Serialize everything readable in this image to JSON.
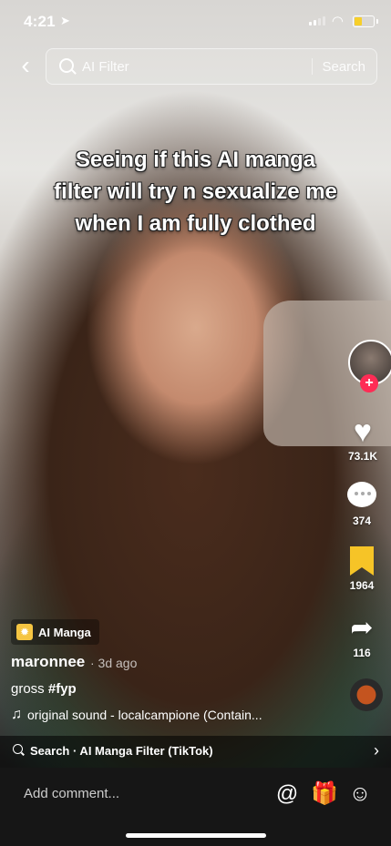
{
  "status_bar": {
    "time": "4:21",
    "location_glyph": "➤",
    "battery_color": "#f7cf2a",
    "battery_level": 0.45
  },
  "search": {
    "query": "AI Filter",
    "button": "Search"
  },
  "caption": {
    "line1": "Seeing if this AI manga",
    "line2": "filter will try n sexualize me",
    "line3": "when I am fully clothed"
  },
  "actions": {
    "likes": "73.1K",
    "comments": "374",
    "saves": "1964",
    "shares": "116",
    "follow_symbol": "+"
  },
  "effect": {
    "label": "AI Manga"
  },
  "post": {
    "username": "maronnee",
    "age": "· 3d ago",
    "desc_text": "gross ",
    "hashtag": "#fyp",
    "sound": "original sound - localcampione (Contain..."
  },
  "related": {
    "text": "Search · AI Manga Filter (TikTok)",
    "chevron": "›"
  },
  "comment_bar": {
    "placeholder": "Add comment..."
  },
  "icons": {
    "back": "chevron-left-icon",
    "search": "search-icon",
    "heart": "heart-icon",
    "comment": "comment-icon",
    "bookmark": "bookmark-icon",
    "share": "share-icon",
    "music": "music-note-icon",
    "mention": "at-icon",
    "gift": "gift-icon",
    "emoji": "emoji-icon"
  },
  "colors": {
    "follow": "#fe2c55",
    "bookmark": "#f6c427",
    "effect_badge": "#f5c542"
  }
}
